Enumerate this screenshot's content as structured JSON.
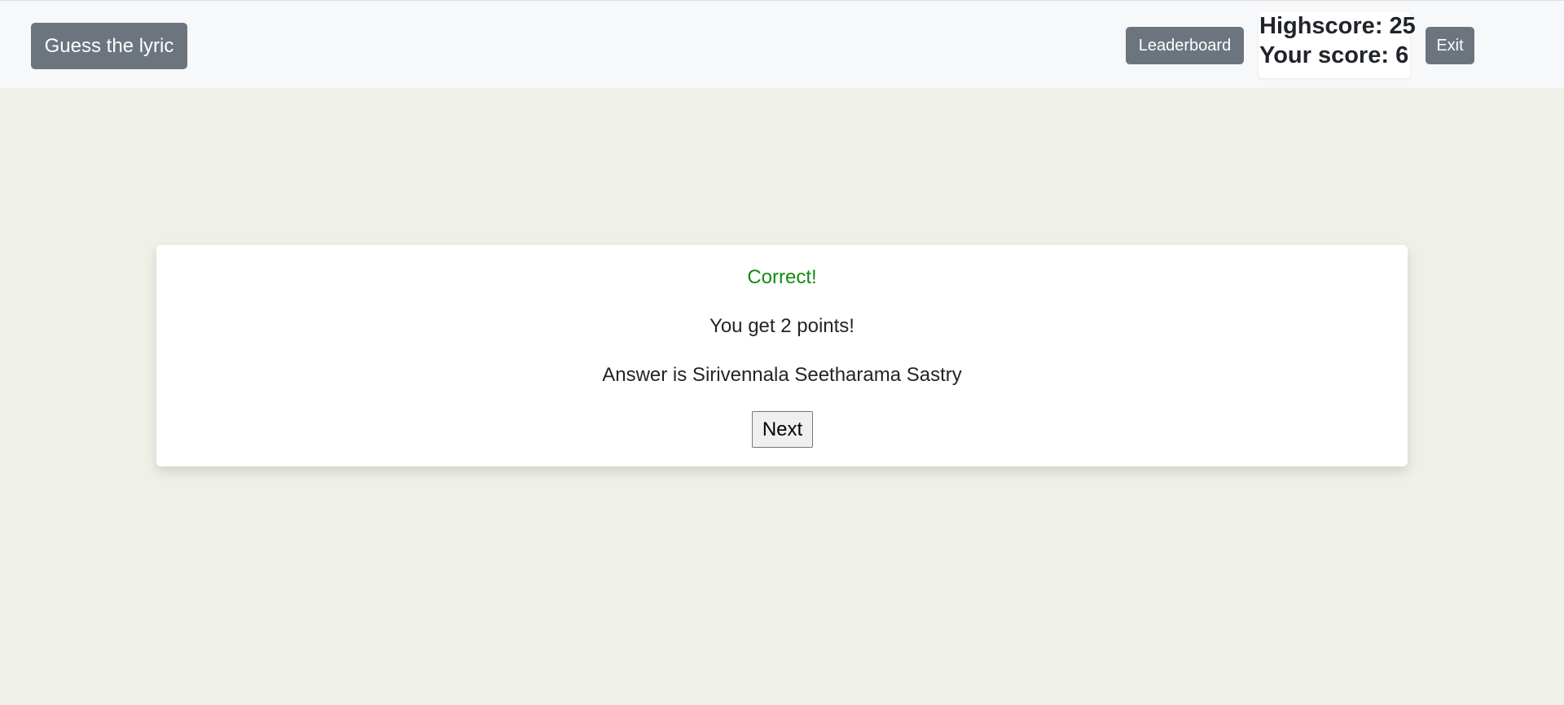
{
  "navbar": {
    "brand_label": "Guess the lyric",
    "leaderboard_label": "Leaderboard",
    "exit_label": "Exit",
    "highscore_label": "Highscore:",
    "highscore_value": "25",
    "your_score_label": "Your score:",
    "your_score_value": "6"
  },
  "result": {
    "status": "Correct!",
    "points_message": "You get 2 points!",
    "answer_message": "Answer is Sirivennala Seetharama Sastry",
    "next_label": "Next"
  },
  "colors": {
    "page_background": "#eff0e8",
    "navbar_background": "#f7f8fa",
    "button_gray": "#6c757d",
    "correct_green": "#138a13"
  }
}
